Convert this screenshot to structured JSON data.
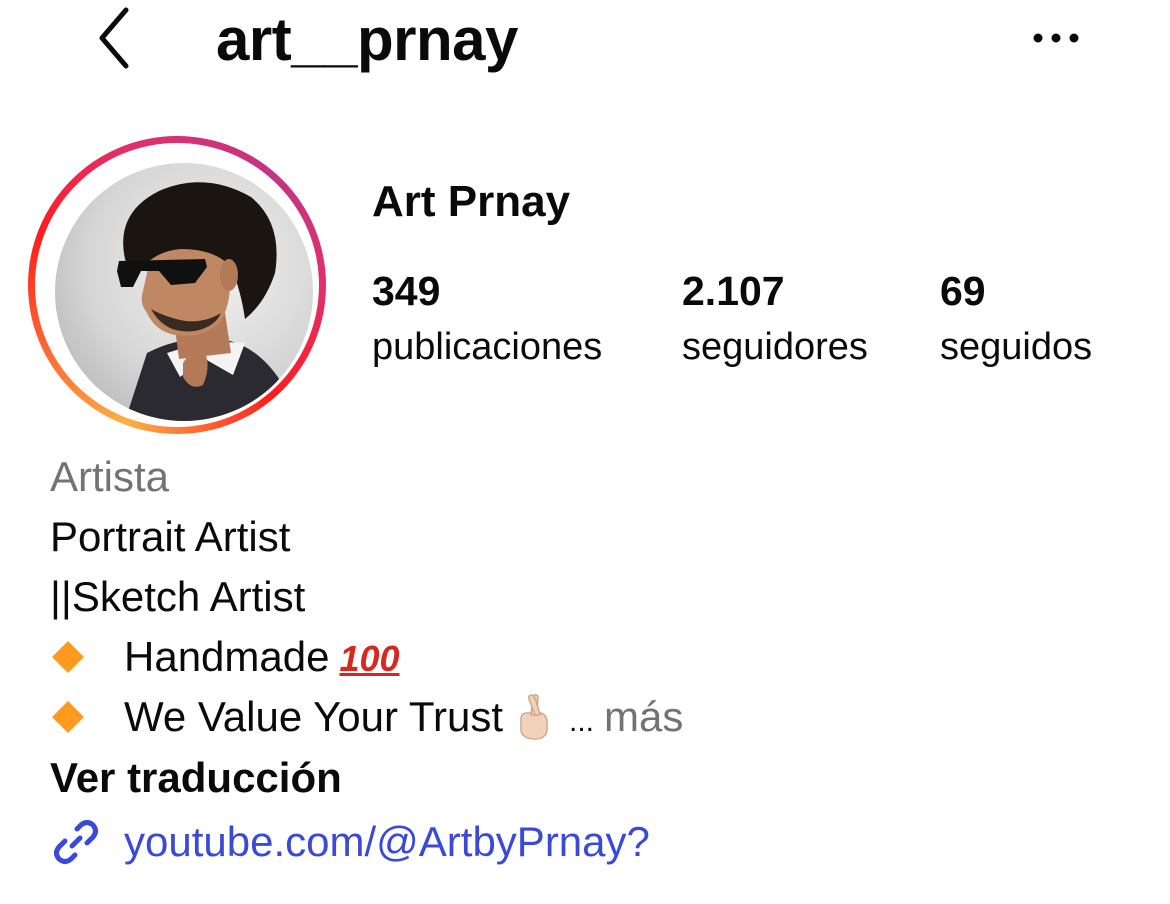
{
  "header": {
    "username": "art__prnay",
    "back_icon": "chevron-left-icon",
    "more_icon": "more-horizontal-icon"
  },
  "profile": {
    "display_name": "Art Prnay",
    "story_ring_colors": [
      "#fcb045",
      "#fd1d1d",
      "#e1306c",
      "#c13584"
    ]
  },
  "stats": [
    {
      "value": "349",
      "label": "publicaciones"
    },
    {
      "value": "2.107",
      "label": "seguidores"
    },
    {
      "value": "69",
      "label": "seguidos"
    }
  ],
  "bio": {
    "category": "Artista",
    "lines": [
      "Portrait Artist",
      "||Sketch Artist",
      "Handmade",
      "We Value Your Trust"
    ],
    "hundred_emoji": "100",
    "ellipsis": "...",
    "more_label": "más",
    "translate_label": "Ver traducción"
  },
  "link": {
    "icon": "link-icon",
    "text": "youtube.com/@ArtbyPrnay?",
    "color": "#3a49d8"
  },
  "colors": {
    "text_primary": "#0a0a0a",
    "text_secondary": "#737373",
    "link": "#3a49d8",
    "diamond": "#ff9a1f"
  }
}
